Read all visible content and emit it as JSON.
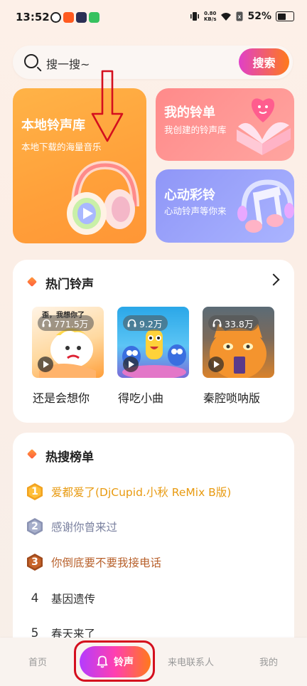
{
  "status_bar": {
    "time": "13:52",
    "net_speed_value": "0.80",
    "net_speed_unit": "KB/s",
    "battery": "52%",
    "app_icons": [
      "#222222",
      "#ff5a1f",
      "#2b2f55",
      "#37c15f"
    ]
  },
  "search": {
    "placeholder": "搜一搜~",
    "button": "搜索"
  },
  "cards": {
    "local": {
      "title": "本地铃声库",
      "subtitle": "本地下载的海量音乐"
    },
    "mine": {
      "title": "我的铃单",
      "subtitle": "我创建的铃声库"
    },
    "heart": {
      "title": "心动彩铃",
      "subtitle": "心动铃声等你来"
    }
  },
  "hot": {
    "title": "热门铃声",
    "items": [
      {
        "title": "还是会想你",
        "plays": "771.5万",
        "overlay": "歪，我想你了"
      },
      {
        "title": "得吃小曲",
        "plays": "9.2万"
      },
      {
        "title": "秦腔唢呐版",
        "plays": "33.8万"
      }
    ]
  },
  "trending": {
    "title": "热搜榜单",
    "items": [
      {
        "rank": "1",
        "title": "爱都爱了(DjCupid.小秋 ReMix B版)",
        "color": "#f0a11a"
      },
      {
        "rank": "2",
        "title": "感谢你曾来过",
        "color": "#7f86a3"
      },
      {
        "rank": "3",
        "title": "你倒底要不要我接电话",
        "color": "#c0652a"
      },
      {
        "rank": "4",
        "title": "基因遗传",
        "color": "#333333"
      },
      {
        "rank": "5",
        "title": "春天来了",
        "color": "#333333"
      }
    ]
  },
  "tabs": {
    "home": "首页",
    "ringtone": "铃声",
    "contacts": "来电联系人",
    "me": "我的"
  },
  "colors": {
    "accent_start": "#e040c8",
    "accent_end": "#ff7a1a",
    "annotation": "#d40f1e"
  }
}
